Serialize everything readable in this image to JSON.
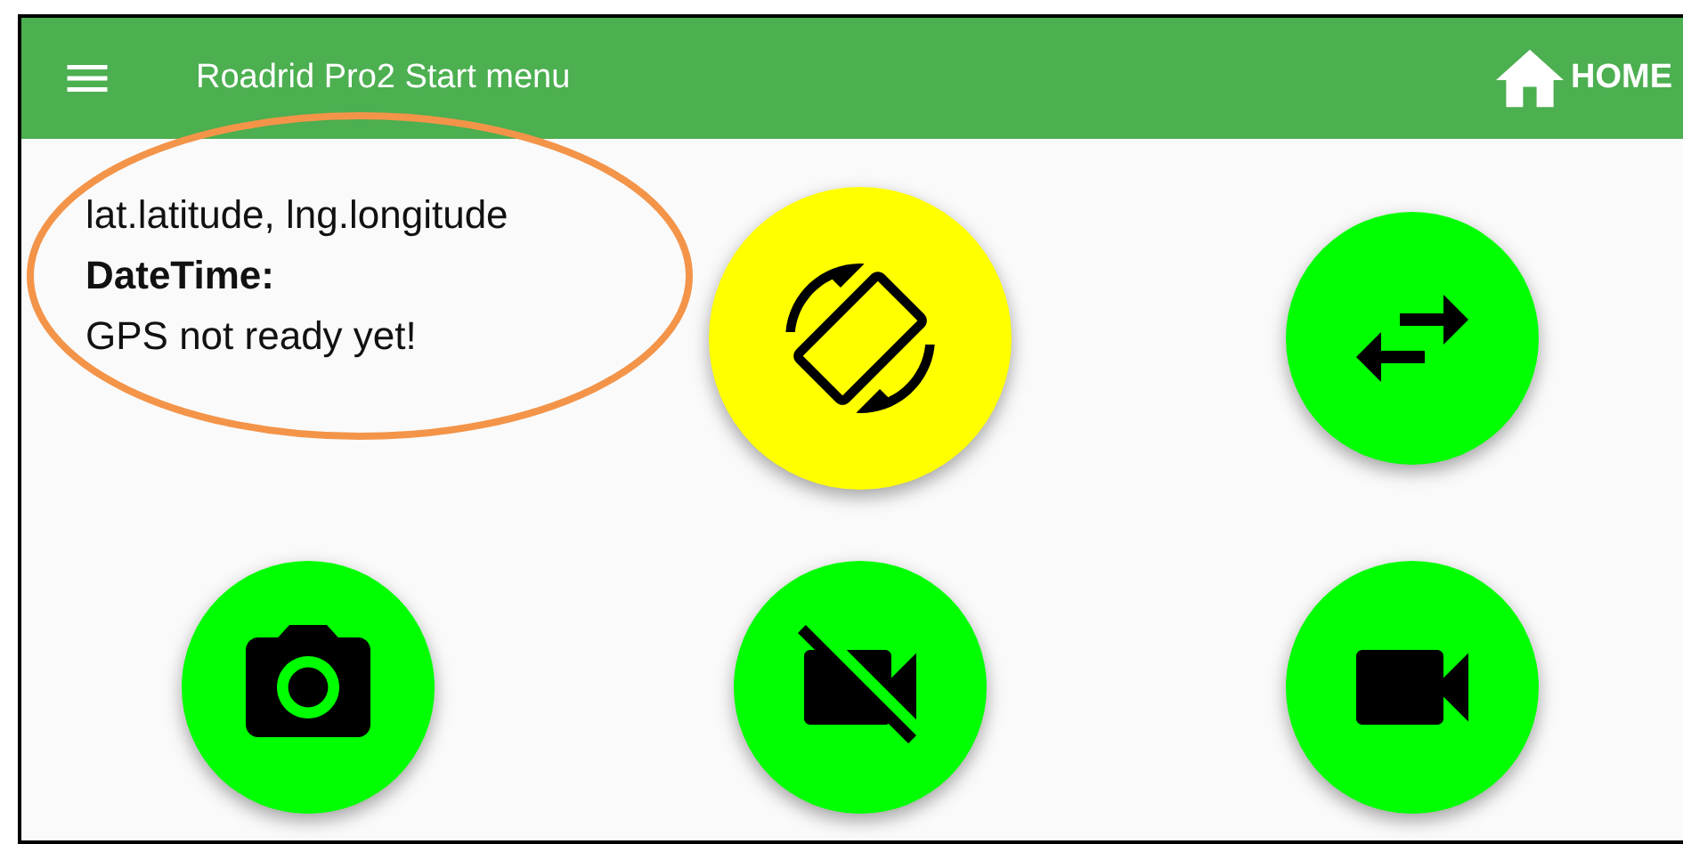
{
  "app_bar": {
    "title": "Roadrid Pro2 Start menu",
    "home_label": "HOME"
  },
  "gps_info": [
    {
      "text": "lat.latitude, lng.longitude",
      "bold": false
    },
    {
      "text": "DateTime:",
      "bold": true
    },
    {
      "text": "GPS not ready yet!",
      "bold": false
    }
  ],
  "actions": [
    {
      "kind": "rotate",
      "selected": true
    },
    {
      "kind": "swap",
      "selected": false
    },
    {
      "kind": "camera",
      "selected": false
    },
    {
      "kind": "video-off",
      "selected": false
    },
    {
      "kind": "video",
      "selected": false
    }
  ]
}
